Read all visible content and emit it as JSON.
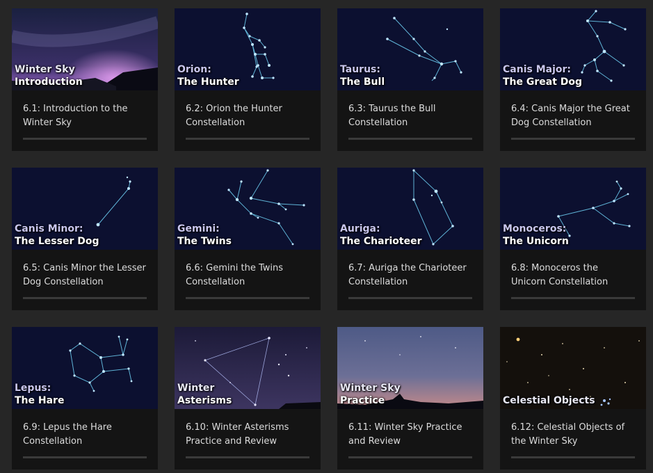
{
  "cards": [
    {
      "title_line1": "Winter Sky",
      "title_line2": "Introduction",
      "caption": "6.1: Introduction to the Winter Sky",
      "thumb": "photo-milkyway",
      "progress": 0
    },
    {
      "title_line1": "Orion:",
      "title_line2": "The Hunter",
      "caption": "6.2: Orion the Hunter Constellation",
      "thumb": "constellation-orion",
      "progress": 0
    },
    {
      "title_line1": "Taurus:",
      "title_line2": "The Bull",
      "caption": "6.3: Taurus the Bull Constellation",
      "thumb": "constellation-taurus",
      "progress": 0
    },
    {
      "title_line1": "Canis Major:",
      "title_line2": "The Great Dog",
      "caption": "6.4: Canis Major the Great Dog Constellation",
      "thumb": "constellation-canis-major",
      "progress": 0
    },
    {
      "title_line1": "Canis Minor:",
      "title_line2": "The Lesser Dog",
      "caption": "6.5: Canis Minor the Lesser Dog Constellation",
      "thumb": "constellation-canis-minor",
      "progress": 0
    },
    {
      "title_line1": "Gemini:",
      "title_line2": "The Twins",
      "caption": "6.6: Gemini the Twins Constellation",
      "thumb": "constellation-gemini",
      "progress": 0
    },
    {
      "title_line1": "Auriga:",
      "title_line2": "The Charioteer",
      "caption": "6.7: Auriga the Charioteer Constellation",
      "thumb": "constellation-auriga",
      "progress": 0
    },
    {
      "title_line1": "Monoceros:",
      "title_line2": "The Unicorn",
      "caption": "6.8: Monoceros the Unicorn Constellation",
      "thumb": "constellation-monoceros",
      "progress": 0
    },
    {
      "title_line1": "Lepus:",
      "title_line2": "The Hare",
      "caption": "6.9: Lepus the Hare Constellation",
      "thumb": "constellation-lepus",
      "progress": 0
    },
    {
      "title_line1": "Winter",
      "title_line2": "Asterisms",
      "caption": "6.10: Winter Asterisms Practice and Review",
      "thumb": "photo-asterism",
      "progress": 0
    },
    {
      "title_line1": "Winter Sky",
      "title_line2": "Practice",
      "caption": "6.11: Winter Sky Practice and Review",
      "thumb": "photo-dusk",
      "progress": 0
    },
    {
      "title_line1": "Celestial Objects",
      "title_line2": "",
      "caption": "6.12: Celestial Objects of the Winter Sky",
      "thumb": "photo-starfield",
      "progress": 0
    }
  ],
  "colors": {
    "page_bg": "#262626",
    "card_bg": "#141414",
    "caption_text": "#dcdcdc",
    "constellation_line": "#5fb3d6",
    "title_accent": "#c9c6ee"
  }
}
